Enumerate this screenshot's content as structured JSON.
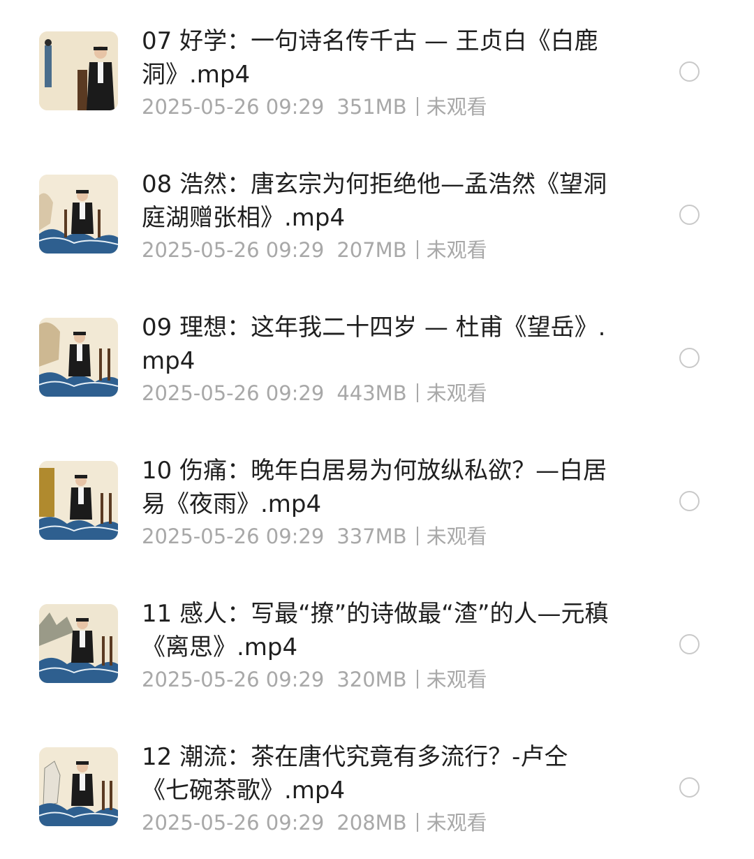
{
  "files": [
    {
      "title": "07 好学：一句诗名传千古 — 王贞白《白鹿洞》.mp4",
      "date": "2025-05-26 09:29",
      "size": "351MB",
      "status": "未观看"
    },
    {
      "title": "08 浩然：唐玄宗为何拒绝他—孟浩然《望洞庭湖赠张相》.mp4",
      "date": "2025-05-26 09:29",
      "size": "207MB",
      "status": "未观看"
    },
    {
      "title": "09 理想：这年我二十四岁 — 杜甫《望岳》.mp4",
      "date": "2025-05-26 09:29",
      "size": "443MB",
      "status": "未观看"
    },
    {
      "title": "10 伤痛：晚年白居易为何放纵私欲？—白居易《夜雨》.mp4",
      "date": "2025-05-26 09:29",
      "size": "337MB",
      "status": "未观看"
    },
    {
      "title": "11 感人：写最“撩”的诗做最“渣”的人—元稹《离思》.mp4",
      "date": "2025-05-26 09:29",
      "size": "320MB",
      "status": "未观看"
    },
    {
      "title": "12 潮流：茶在唐代究竟有多流行？-卢仝《七碗茶歌》.mp4",
      "date": "2025-05-26 09:29",
      "size": "208MB",
      "status": "未观看"
    }
  ]
}
